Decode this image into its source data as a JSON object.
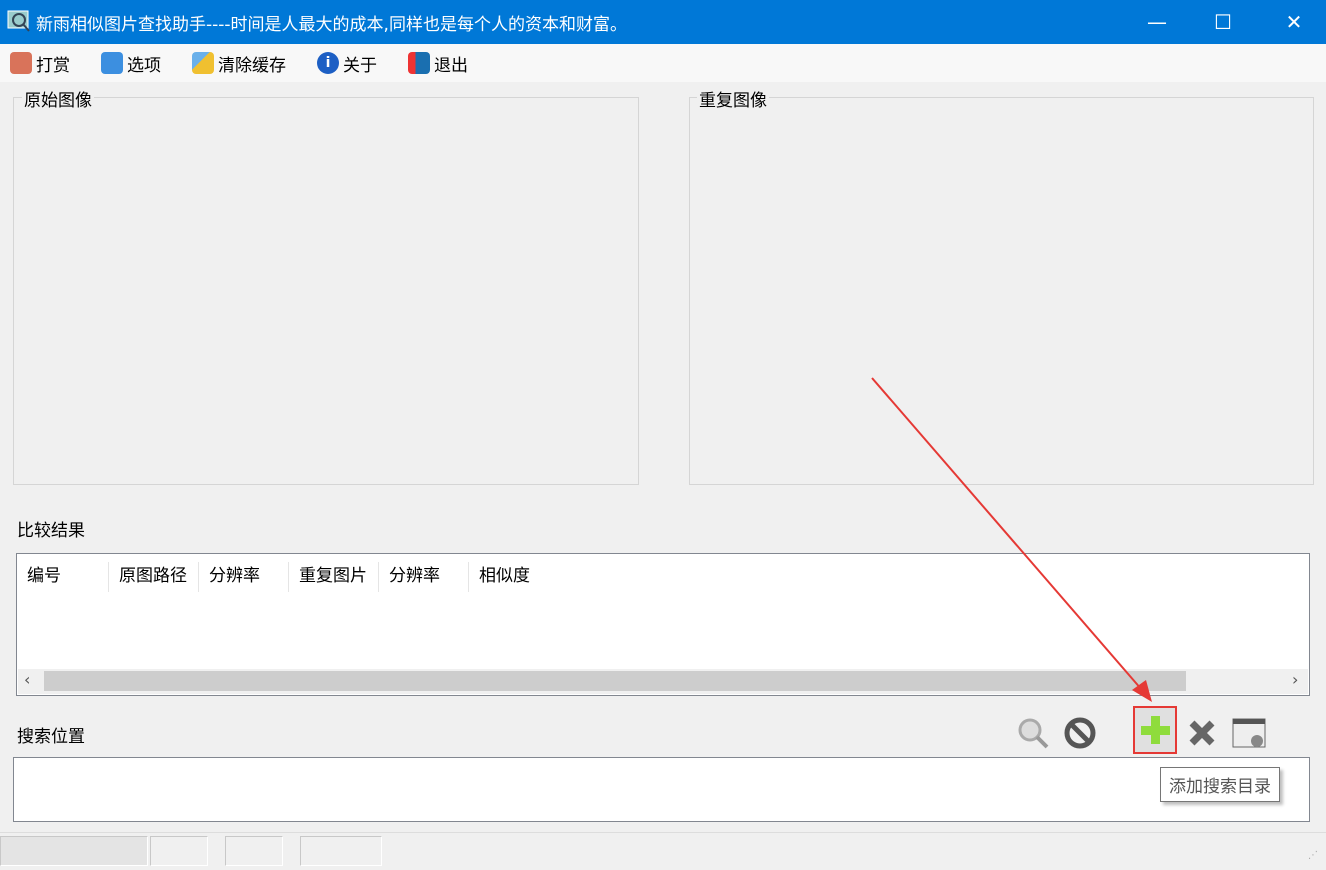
{
  "window": {
    "title": "新雨相似图片查找助手----时间是人最大的成本,同样也是每个人的资本和财富。",
    "minimize": "—",
    "maximize": "☐",
    "close": "✕"
  },
  "menu": [
    {
      "label": "打赏",
      "icon": "gift-icon"
    },
    {
      "label": "选项",
      "icon": "gear-icon"
    },
    {
      "label": "清除缓存",
      "icon": "broom-icon"
    },
    {
      "label": "关于",
      "icon": "info-icon"
    },
    {
      "label": "退出",
      "icon": "exit-door-icon"
    }
  ],
  "panels": {
    "original": "原始图像",
    "duplicate": "重复图像"
  },
  "results": {
    "label": "比较结果",
    "columns": [
      "编号",
      "原图路径",
      "分辨率",
      "重复图片",
      "分辨率",
      "相似度"
    ],
    "rows": []
  },
  "search": {
    "label": "搜索位置",
    "tooltip": "添加搜索目录",
    "toolbar": [
      "search-icon",
      "stop-icon",
      "add-icon",
      "delete-icon",
      "clear-list-icon"
    ]
  },
  "colors": {
    "titlebar": "#0078d7",
    "annotation": "#e53935"
  }
}
